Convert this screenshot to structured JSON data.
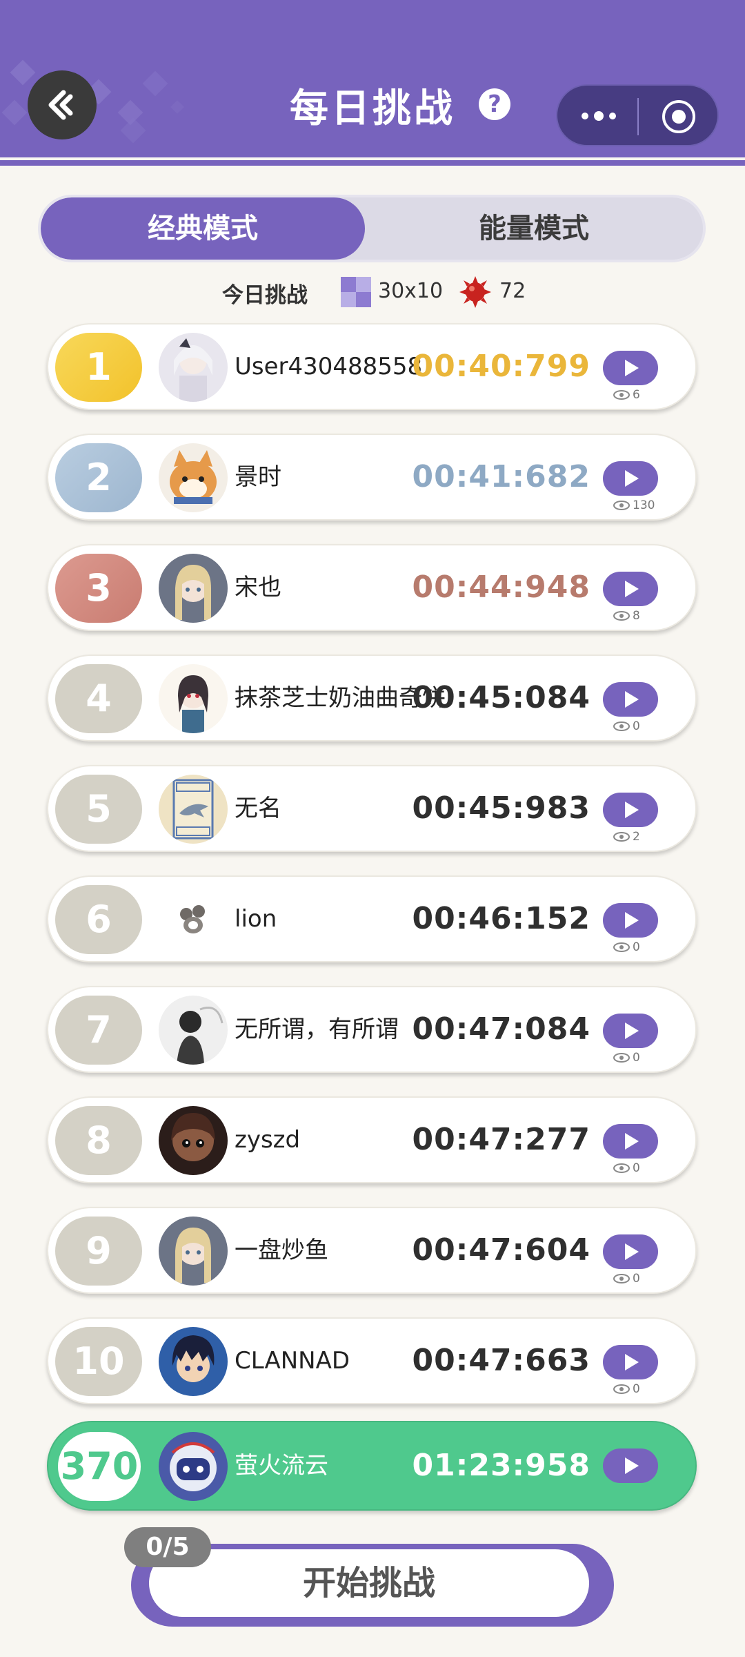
{
  "header": {
    "title": "每日挑战",
    "help_icon": "?",
    "accent_color": "#7763bd"
  },
  "tabs": [
    {
      "label": "经典模式",
      "active": true
    },
    {
      "label": "能量模式",
      "active": false
    }
  ],
  "info": {
    "label": "今日挑战",
    "board_size": "30x10",
    "mines": "72"
  },
  "leaderboard": [
    {
      "rank": "1",
      "name": "User430488558",
      "time": "00:40:799",
      "views": "6",
      "medal": "gold"
    },
    {
      "rank": "2",
      "name": "景时",
      "time": "00:41:682",
      "views": "130",
      "medal": "silver"
    },
    {
      "rank": "3",
      "name": "宋也",
      "time": "00:44:948",
      "views": "8",
      "medal": "bronze"
    },
    {
      "rank": "4",
      "name": "抹茶芝士奶油曲奇饼",
      "time": "00:45:084",
      "views": "0",
      "medal": "none"
    },
    {
      "rank": "5",
      "name": "无名",
      "time": "00:45:983",
      "views": "2",
      "medal": "none"
    },
    {
      "rank": "6",
      "name": "lion",
      "time": "00:46:152",
      "views": "0",
      "medal": "none"
    },
    {
      "rank": "7",
      "name": "无所谓，有所谓",
      "time": "00:47:084",
      "views": "0",
      "medal": "none"
    },
    {
      "rank": "8",
      "name": "zyszd",
      "time": "00:47:277",
      "views": "0",
      "medal": "none"
    },
    {
      "rank": "9",
      "name": "一盘炒鱼",
      "time": "00:47:604",
      "views": "0",
      "medal": "none"
    },
    {
      "rank": "10",
      "name": "CLANNAD",
      "time": "00:47:663",
      "views": "0",
      "medal": "none"
    }
  ],
  "my_entry": {
    "rank": "370",
    "name": "萤火流云",
    "time": "01:23:958",
    "highlight_color": "#4fc98d"
  },
  "start": {
    "label": "开始挑战",
    "attempts": "0/5"
  }
}
